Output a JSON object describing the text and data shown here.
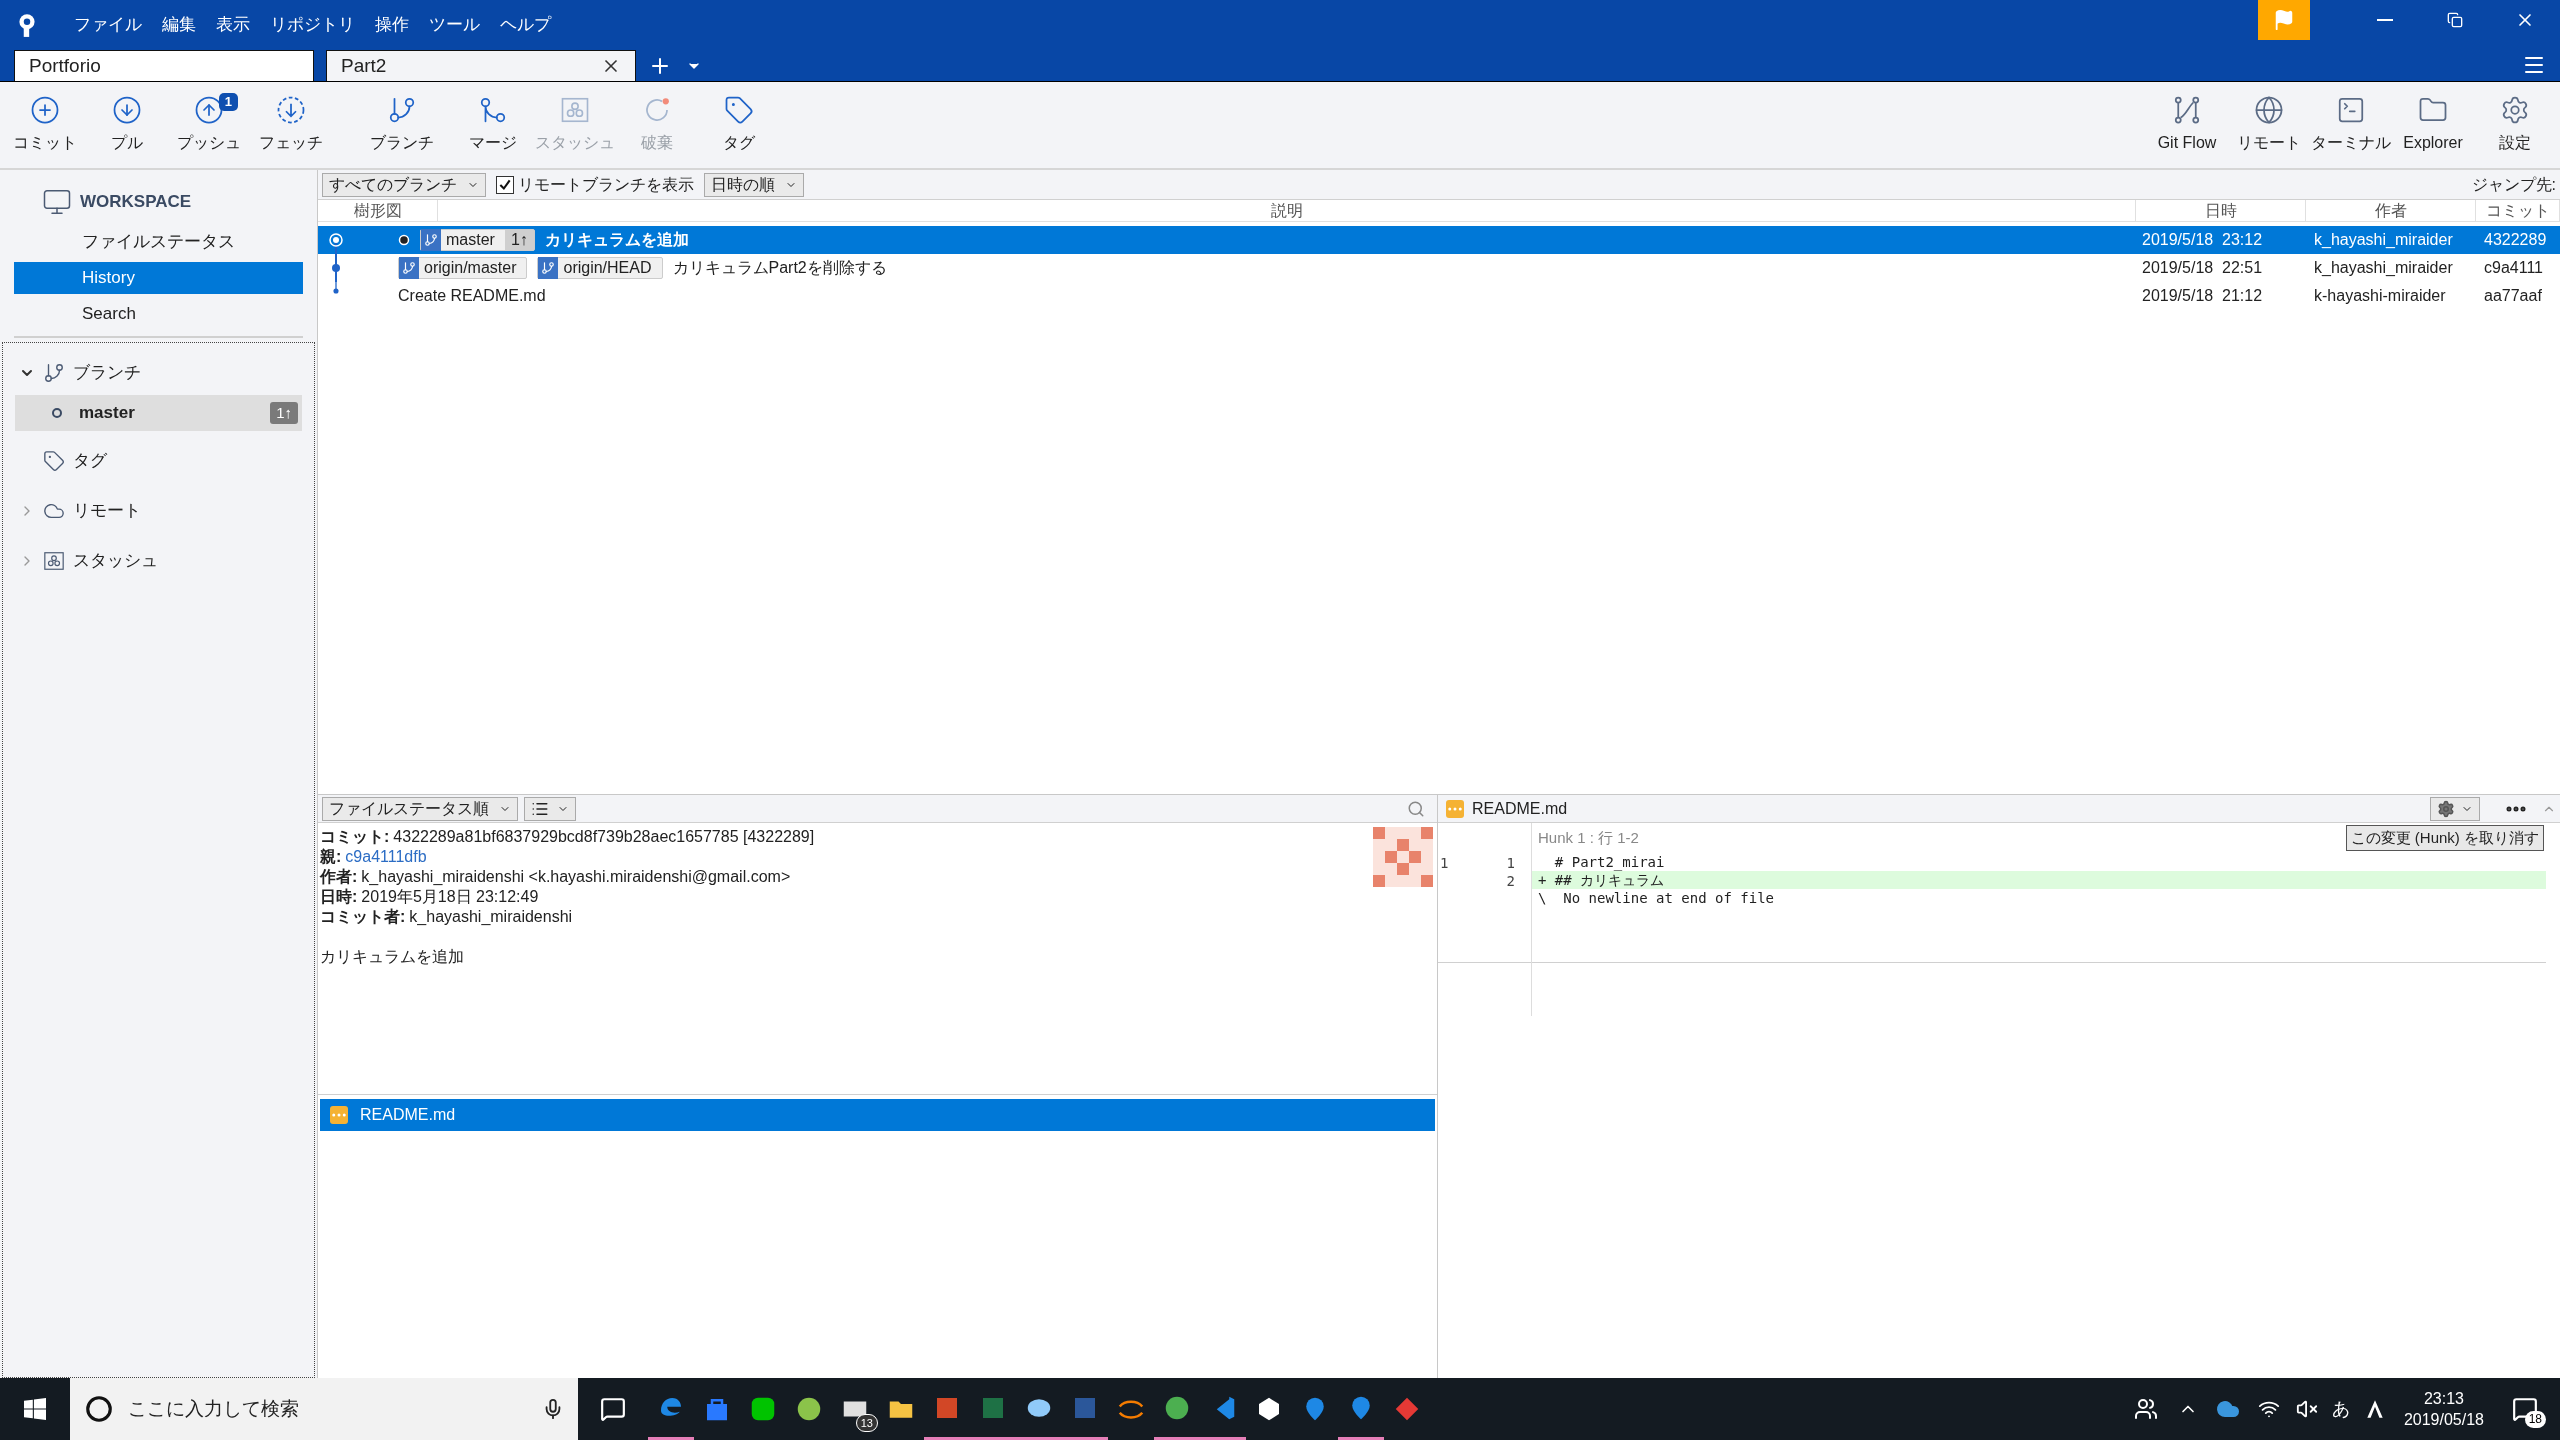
{
  "menu": [
    "ファイル",
    "編集",
    "表示",
    "リポジトリ",
    "操作",
    "ツール",
    "ヘルプ"
  ],
  "tabs": [
    {
      "label": "Portforio",
      "selected": false
    },
    {
      "label": "Part2",
      "selected": true
    }
  ],
  "toolbar_left": [
    {
      "kind": "commit",
      "label": "コミット",
      "disabled": false
    },
    {
      "kind": "pull",
      "label": "プル",
      "disabled": false
    },
    {
      "kind": "push",
      "label": "プッシュ",
      "disabled": false,
      "badge": "1"
    },
    {
      "kind": "fetch",
      "label": "フェッチ",
      "disabled": false
    },
    {
      "kind": "branch",
      "label": "ブランチ",
      "disabled": false
    },
    {
      "kind": "merge",
      "label": "マージ",
      "disabled": false
    },
    {
      "kind": "stash",
      "label": "スタッシュ",
      "disabled": true
    },
    {
      "kind": "discard",
      "label": "破棄",
      "disabled": true
    },
    {
      "kind": "tag",
      "label": "タグ",
      "disabled": false
    }
  ],
  "toolbar_right": [
    {
      "kind": "gitflow",
      "label": "Git Flow"
    },
    {
      "kind": "remote",
      "label": "リモート"
    },
    {
      "kind": "terminal",
      "label": "ターミナル"
    },
    {
      "kind": "explorer",
      "label": "Explorer"
    },
    {
      "kind": "settings",
      "label": "設定"
    }
  ],
  "sidebar": {
    "workspace": "WORKSPACE",
    "workspace_items": [
      {
        "label": "ファイルステータス",
        "selected": false
      },
      {
        "label": "History",
        "selected": true
      },
      {
        "label": "Search",
        "selected": false
      }
    ],
    "sections": [
      {
        "kind": "branch",
        "label": "ブランチ",
        "expanded": true,
        "children": [
          {
            "label": "master",
            "badge": "1↑",
            "selected": true
          }
        ]
      },
      {
        "kind": "tag",
        "label": "タグ"
      },
      {
        "kind": "remote",
        "label": "リモート",
        "expanded": false
      },
      {
        "kind": "stash",
        "label": "スタッシュ",
        "expanded": false
      }
    ]
  },
  "filter": {
    "branches": "すべてのブランチ",
    "show_remote": {
      "label": "リモートブランチを表示",
      "checked": true
    },
    "sort": "日時の順",
    "jump": "ジャンプ先:"
  },
  "columns": [
    "樹形図",
    "説明",
    "日時",
    "作者",
    "コミット"
  ],
  "commits": [
    {
      "selected": true,
      "head": true,
      "refs": [
        {
          "name": "master",
          "count": "1↑"
        }
      ],
      "message": "カリキュラムを追加",
      "date": "2019/5/18  23:12",
      "author": "k_hayashi_miraider",
      "hash": "4322289"
    },
    {
      "selected": false,
      "head": false,
      "refs": [
        {
          "name": "origin/master"
        },
        {
          "name": "origin/HEAD"
        }
      ],
      "message": "カリキュラムPart2を削除する",
      "date": "2019/5/18  22:51",
      "author": "k_hayashi_miraider",
      "hash": "c9a4111"
    },
    {
      "selected": false,
      "head": false,
      "message": "Create README.md",
      "date": "2019/5/18  21:12",
      "author": "k-hayashi-miraider",
      "hash": "aa77aaf"
    }
  ],
  "details": {
    "sort": "ファイルステータス順",
    "fields": [
      {
        "label": "コミット:",
        "value": "4322289a81bf6837929bcd8f739b28aec1657785 [4322289]",
        "kind": "text"
      },
      {
        "label": "親:",
        "value": "c9a4111dfb",
        "kind": "link"
      },
      {
        "label": "作者:",
        "value": "k_hayashi_miraidenshi <k.hayashi.miraidenshi@gmail.com>",
        "kind": "text"
      },
      {
        "label": "日時:",
        "value": "2019年5月18日 23:12:49",
        "kind": "text"
      },
      {
        "label": "コミット者:",
        "value": "k_hayashi_miraidenshi",
        "kind": "text"
      }
    ],
    "message": "カリキュラムを追加",
    "files": [
      {
        "name": "README.md",
        "selected": true
      }
    ]
  },
  "diff": {
    "file": "README.md",
    "hunk": "Hunk 1 : 行 1-2",
    "discard": "この変更 (Hunk) を取り消す",
    "lines": [
      {
        "kind": "context",
        "old": "1",
        "new": "1",
        "text": "  # Part2_mirai"
      },
      {
        "kind": "added",
        "new": "2",
        "text": "+ ## カリキュラム"
      },
      {
        "kind": "note",
        "text": "\\  No newline at end of file"
      }
    ]
  },
  "taskbar": {
    "search": "ここに入力して検索",
    "apps": [
      {
        "kind": "edge",
        "color": "#1e88e5",
        "running": true
      },
      {
        "kind": "store",
        "color": "#2979ff",
        "running": false
      },
      {
        "kind": "chat",
        "color": "#00c300",
        "running": false
      },
      {
        "kind": "android",
        "color": "#8bc34a",
        "running": false
      },
      {
        "kind": "mail",
        "color": "#e0e0e0",
        "running": false,
        "badge": "13"
      },
      {
        "kind": "folder",
        "color": "#f6c343",
        "running": false
      },
      {
        "kind": "slides",
        "color": "#d24726",
        "running": true
      },
      {
        "kind": "sheet",
        "color": "#1e7145",
        "running": true
      },
      {
        "kind": "paint",
        "color": "#90caf9",
        "running": true
      },
      {
        "kind": "doc",
        "color": "#2b579a",
        "running": true
      },
      {
        "kind": "arc",
        "color": "#f57c00",
        "running": false
      },
      {
        "kind": "browser",
        "color": "#4caf50",
        "running": true
      },
      {
        "kind": "code",
        "color": "#1e88e5",
        "running": true
      },
      {
        "kind": "unity",
        "color": "#ffffff",
        "running": false
      },
      {
        "kind": "pin",
        "color": "#1e88e5",
        "running": false
      },
      {
        "kind": "pin",
        "color": "#1e88e5",
        "running": true
      },
      {
        "kind": "gem",
        "color": "#e53935",
        "running": false
      }
    ],
    "ime": "あ",
    "time": "23:13",
    "date": "2019/05/18",
    "notifications": "18"
  }
}
